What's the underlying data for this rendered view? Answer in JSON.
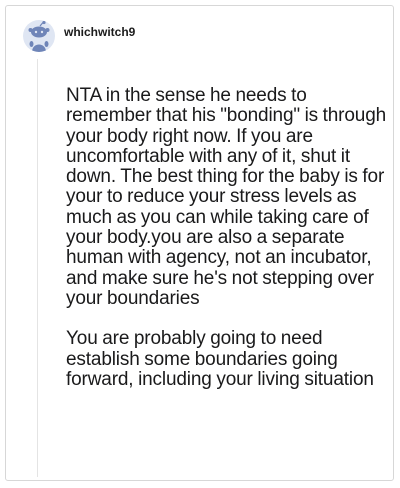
{
  "comment": {
    "username": "whichwitch9",
    "avatar_icon": "snoo-avatar-icon",
    "paragraphs": [
      "NTA in the sense he needs to remember that his \"bonding\" is through your body right now. If you are uncomfortable with any of it, shut it down. The best thing for the baby is for your to reduce your stress levels as much as you can while taking care of your body.you are also a separate human with agency, not an incubator, and make sure he's not stepping over your boundaries",
      "You are probably going to need establish some boundaries going forward, including your living situation"
    ]
  },
  "colors": {
    "avatar_bg": "#dfe6f3",
    "avatar_figure": "#6f85b8",
    "thread_line": "#e4e4e4",
    "text": "#1a1a1b"
  }
}
